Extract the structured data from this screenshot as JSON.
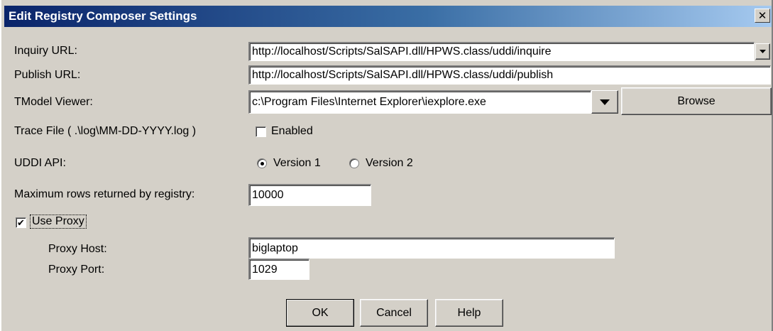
{
  "window": {
    "title": "Edit Registry Composer Settings",
    "close_glyph": "✕"
  },
  "form": {
    "inquiry_url": {
      "label": "Inquiry URL:",
      "value": "http://localhost/Scripts/SalSAPI.dll/HPWS.class/uddi/inquire"
    },
    "publish_url": {
      "label": "Publish URL:",
      "value": "http://localhost/Scripts/SalSAPI.dll/HPWS.class/uddi/publish"
    },
    "tmodel_viewer": {
      "label": "TModel Viewer:",
      "value": "c:\\Program Files\\Internet Explorer\\iexplore.exe",
      "browse_label": "Browse"
    },
    "trace_file": {
      "label": "Trace File ( .\\log\\MM-DD-YYYY.log )",
      "checkbox_label": "Enabled",
      "checked": false
    },
    "uddi_api": {
      "label": "UDDI API:",
      "options": [
        "Version 1",
        "Version 2"
      ],
      "selected": "Version 1"
    },
    "max_rows": {
      "label": "Maximum rows returned by registry:",
      "value": "10000"
    },
    "use_proxy": {
      "label": "Use Proxy",
      "checked": true,
      "check_glyph": "✔"
    },
    "proxy_host": {
      "label": "Proxy Host:",
      "value": "biglaptop"
    },
    "proxy_port": {
      "label": "Proxy Port:",
      "value": "1029"
    }
  },
  "buttons": {
    "ok": "OK",
    "cancel": "Cancel",
    "help": "Help"
  },
  "icons": {
    "dropdown": "chevron-down-icon",
    "close": "close-icon"
  },
  "colors": {
    "dialog_bg": "#d4d0c8",
    "title_start": "#0a246a",
    "title_end": "#a6caf0"
  }
}
